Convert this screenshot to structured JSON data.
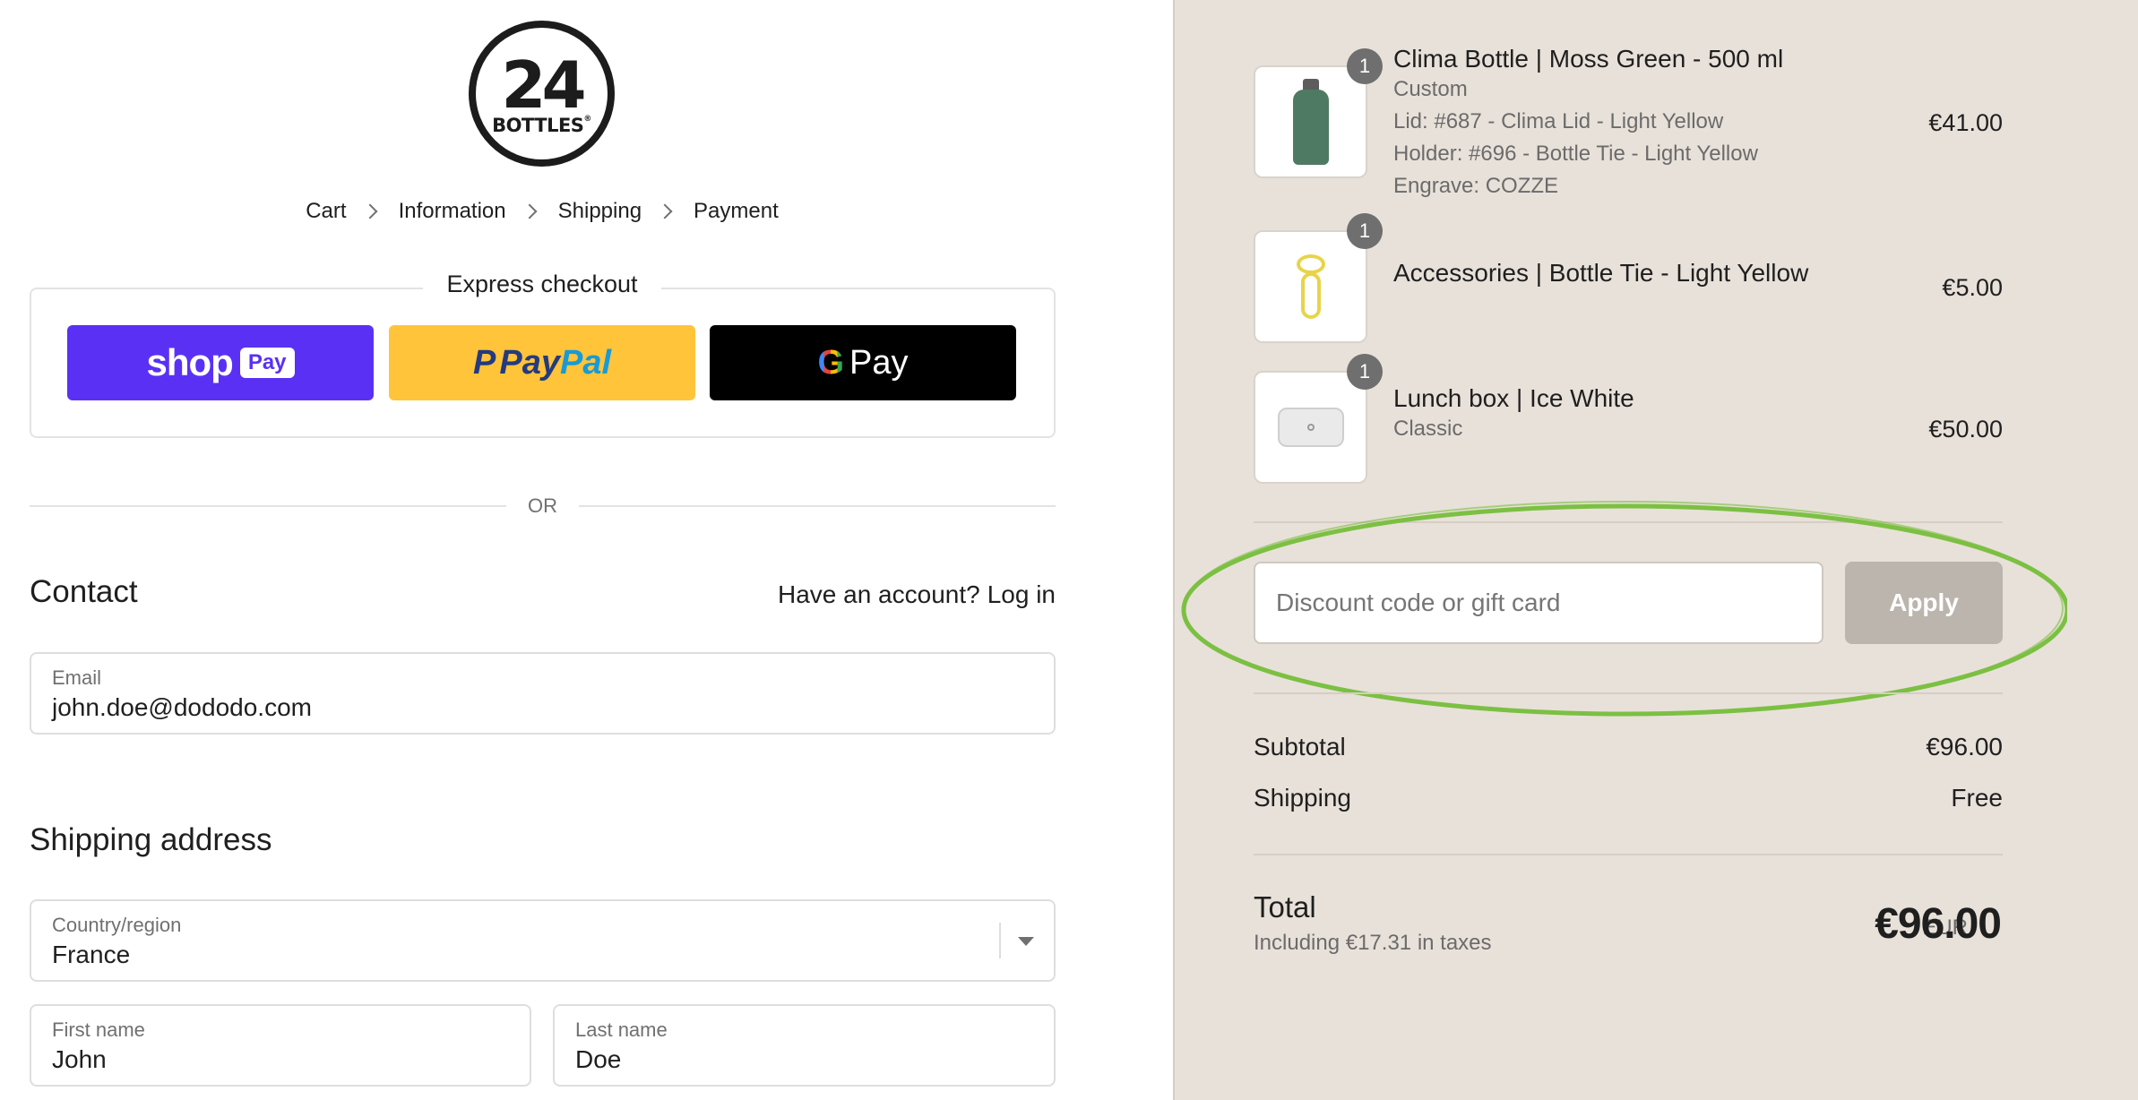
{
  "brand": {
    "logo_number": "24",
    "logo_word": "BOTTLES",
    "logo_mark": "®"
  },
  "breadcrumb": [
    "Cart",
    "Information",
    "Shipping",
    "Payment"
  ],
  "express": {
    "title": "Express checkout",
    "shoppay": {
      "word": "shop",
      "badge": "Pay",
      "color": "#5a31f4"
    },
    "paypal": {
      "word1": "Pay",
      "word2": "Pal",
      "color": "#ffc439"
    },
    "gpay": {
      "g": "G",
      "word": "Pay",
      "color": "#000000"
    }
  },
  "or_text": "OR",
  "contact": {
    "heading": "Contact",
    "account_prompt": "Have an account?",
    "login_link": "Log in",
    "email_label": "Email",
    "email_value": "john.doe@dododo.com"
  },
  "shipping_address": {
    "heading": "Shipping address",
    "country_label": "Country/region",
    "country_value": "France",
    "first_name_label": "First name",
    "first_name_value": "John",
    "last_name_label": "Last name",
    "last_name_value": "Doe"
  },
  "cart_items": [
    {
      "quantity": "1",
      "name": "Clima Bottle | Moss Green - 500 ml",
      "options": [
        "Custom",
        "Lid: #687 - Clima Lid - Light Yellow",
        "Holder: #696 - Bottle Tie - Light Yellow",
        "Engrave: COZZE"
      ],
      "price": "€41.00",
      "image": "bottle-image"
    },
    {
      "quantity": "1",
      "name": "Accessories | Bottle Tie - Light Yellow",
      "options": [],
      "price": "€5.00",
      "image": "bottle-tie-image"
    },
    {
      "quantity": "1",
      "name": "Lunch box | Ice White",
      "options": [
        "Classic"
      ],
      "price": "€50.00",
      "image": "lunch-box-image"
    }
  ],
  "discount": {
    "placeholder": "Discount code or gift card",
    "apply_label": "Apply",
    "highlight_color": "#7cc043"
  },
  "summary": {
    "subtotal_label": "Subtotal",
    "subtotal_value": "€96.00",
    "shipping_label": "Shipping",
    "shipping_value": "Free",
    "total_label": "Total",
    "tax_note": "Including €17.31 in taxes",
    "currency": "EUR",
    "total_value": "€96.00"
  },
  "colors": {
    "sidebar_bg": "#e8e1d9",
    "text": "#1f1f1f",
    "muted": "#707070"
  }
}
